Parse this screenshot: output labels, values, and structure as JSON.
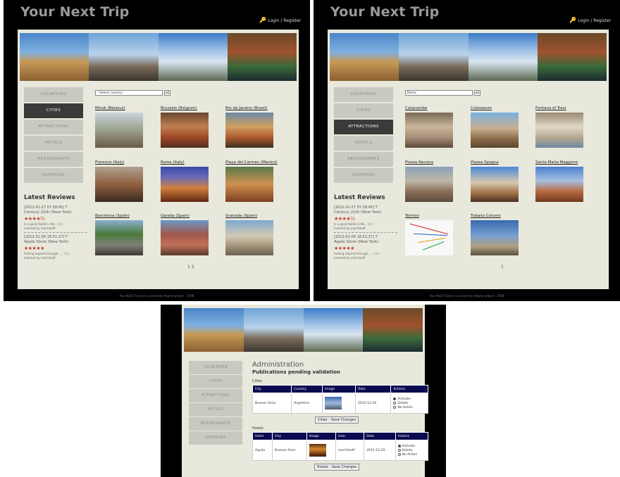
{
  "site": {
    "title": "Your Next Trip",
    "login_label": "Login / Register",
    "footer": "Your Next Travel is a university degree project · 2008"
  },
  "nav": [
    "COUNTRIES",
    "CITIES",
    "ATTRACTIONS",
    "HOTELS",
    "RESTAURANTS",
    "SHOPPING"
  ],
  "reviews": {
    "heading": "Latest Reviews",
    "items": [
      {
        "date": "[2012-01-27 07:28:45] T",
        "title": "Century 21th (New York)",
        "stars": "★★★★½",
        "text": "Is a good Outlet in Ne... [+]",
        "by": "inserted by marinhedf"
      },
      {
        "date": "[2012-01-06 18:51:27] T",
        "title": "Apple Store (New York)",
        "stars": "★★★★★",
        "text": "Feeling inspired through ..... [+]",
        "by": "inserted by marinhedf"
      }
    ]
  },
  "screen1": {
    "active_nav": "CITIES",
    "select_placeholder": "- Select country -",
    "select_button": "ok",
    "items": [
      {
        "caption": "Minsk (Belarus)",
        "img": "i1"
      },
      {
        "caption": "Brussels (Belgium)",
        "img": "i2"
      },
      {
        "caption": "Rio de Janeiro (Brazil)",
        "img": "i3"
      },
      {
        "caption": "Florence (Italy)",
        "img": "i4"
      },
      {
        "caption": "Rome (Italy)",
        "img": "i5"
      },
      {
        "caption": "Playa del Carmen (Mexico)",
        "img": "i6"
      },
      {
        "caption": "Barcelona (Spain)",
        "img": "i7"
      },
      {
        "caption": "Gandia (Spain)",
        "img": "i8"
      },
      {
        "caption": "Granada (Spain)",
        "img": "i9"
      }
    ],
    "pager": "1 2"
  },
  "screen2": {
    "active_nav": "ATTRACTIONS",
    "select_value": "Roma",
    "select_button": "ok",
    "items": [
      {
        "caption": "Catacombe",
        "img": "r1"
      },
      {
        "caption": "Colosseum",
        "img": "r2"
      },
      {
        "caption": "Fontana di Trevi",
        "img": "r3"
      },
      {
        "caption": "Piazza Navona",
        "img": "r4"
      },
      {
        "caption": "Piazza Spagna",
        "img": "r5"
      },
      {
        "caption": "Santa Maria Maggiore",
        "img": "r6"
      },
      {
        "caption": "Termini",
        "img": "r7"
      },
      {
        "caption": "Traiano Column",
        "img": "r8"
      }
    ],
    "pager": "1"
  },
  "admin": {
    "title": "Administration",
    "subtitle": "Publications pending validation",
    "cities": {
      "label": "Cities",
      "headers": [
        "City",
        "Country",
        "Image",
        "Date",
        "Actions"
      ],
      "row": {
        "city": "Buenos Aires",
        "country": "Argentina",
        "date": "2012-12-20"
      },
      "save": "Cities - Save Changes"
    },
    "hotels": {
      "label": "Hotels",
      "headers": [
        "Hotel",
        "City",
        "Image",
        "User",
        "Date",
        "Actions"
      ],
      "row": {
        "hotel": "Aquila",
        "city": "Buenos Aires",
        "user": "marinhedf",
        "date": "2012-12-20"
      },
      "save": "Hotels - Save Changes"
    },
    "actions": [
      "Activate",
      "Delete",
      "No Action"
    ]
  }
}
